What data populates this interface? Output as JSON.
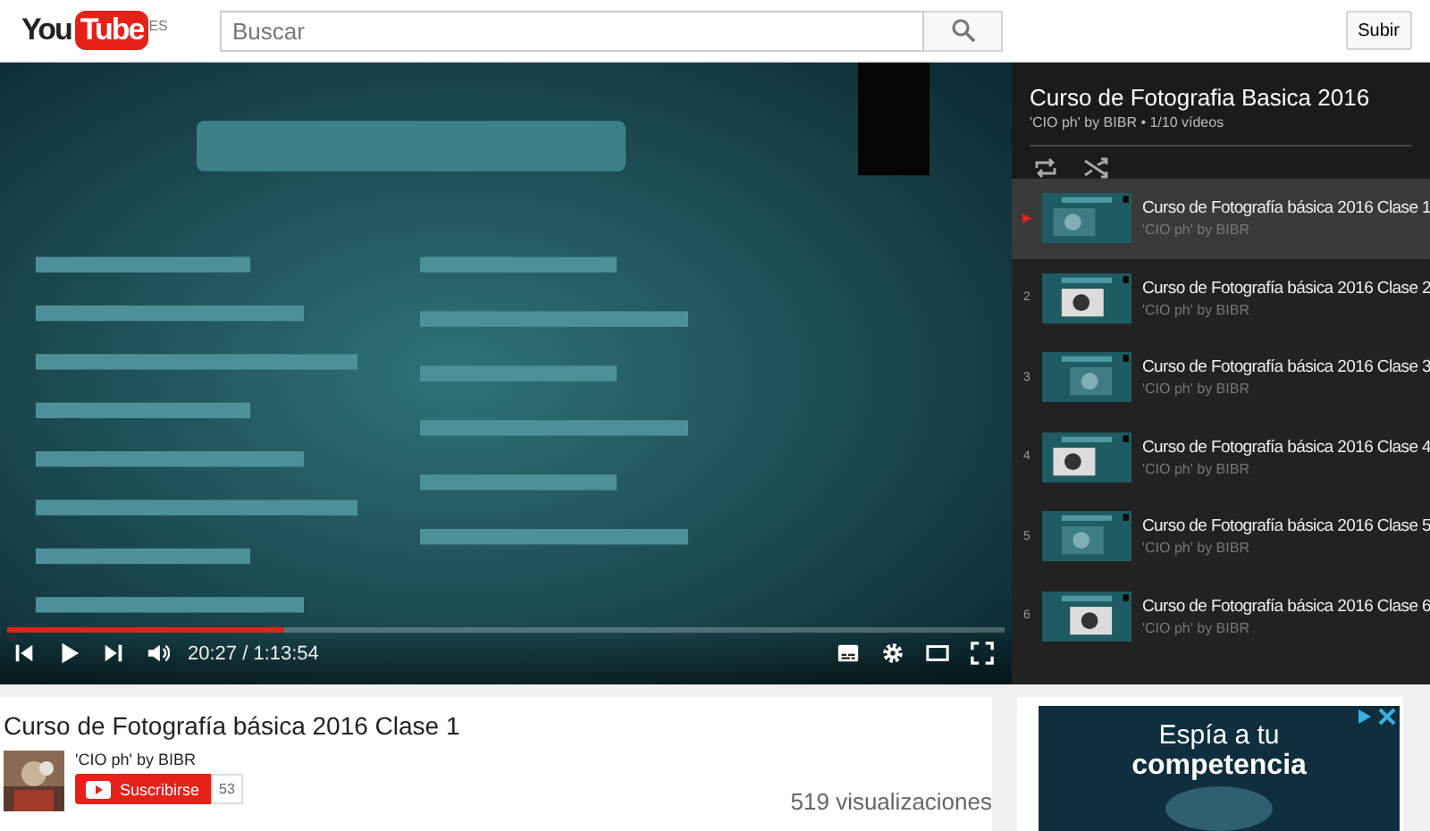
{
  "header": {
    "logo": {
      "word_1": "You",
      "word_2": "Tube",
      "region": "ES"
    },
    "search": {
      "placeholder": "Buscar"
    },
    "upload_button": "Subir"
  },
  "player": {
    "progress": {
      "level": 0.277
    },
    "time": "20:27 / 1:13:54",
    "playing": false
  },
  "playlist": {
    "title": "Curso de Fotografia Basica 2016",
    "meta": "'CIO ph' by BIBR • 1/10 vídeos",
    "items": [
      {
        "marker": "▶",
        "title": "Curso de Fotografía básica 2016 Clase 1",
        "channel": "'CIO ph' by BIBR",
        "selected": true
      },
      {
        "marker": "2",
        "title": "Curso de Fotografía básica 2016 Clase 2",
        "channel": "'CIO ph' by BIBR",
        "selected": false
      },
      {
        "marker": "3",
        "title": "Curso de Fotografía básica 2016 Clase 3",
        "channel": "'CIO ph' by BIBR",
        "selected": false
      },
      {
        "marker": "4",
        "title": "Curso de Fotografía básica 2016 Clase 4",
        "channel": "'CIO ph' by BIBR",
        "selected": false
      },
      {
        "marker": "5",
        "title": "Curso de Fotografía básica 2016 Clase 5",
        "channel": "'CIO ph' by BIBR",
        "selected": false
      },
      {
        "marker": "6",
        "title": "Curso de Fotografía básica 2016 Clase 6",
        "channel": "'CIO ph' by BIBR",
        "selected": false
      }
    ]
  },
  "video": {
    "title": "Curso de Fotografía básica 2016 Clase 1",
    "channel": "'CIO ph' by BIBR",
    "subscribe_button": "Suscribirse",
    "subscriber_count": "53",
    "views": "519 visualizaciones"
  },
  "ad": {
    "line_1": "Espía a tu",
    "line_2": "competencia"
  }
}
